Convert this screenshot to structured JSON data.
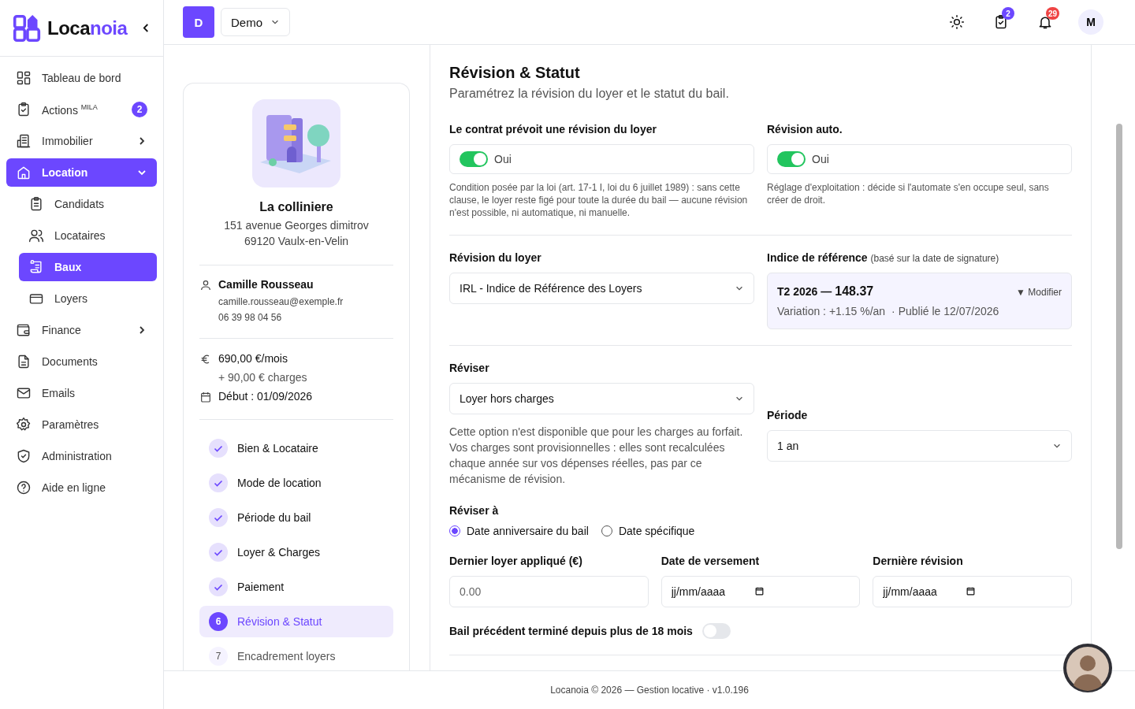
{
  "sidebar": {
    "brand": {
      "first": "Loca",
      "second": "noia"
    },
    "items": [
      {
        "label": "Tableau de bord",
        "selected": false
      },
      {
        "label": "Actions $^{MILA}$",
        "badge": "2",
        "selected": false
      },
      {
        "label": "Immobilier",
        "selected": false,
        "expanded": false
      },
      {
        "label": "Location",
        "selected": true,
        "expanded": true,
        "children": [
          {
            "label": "Candidats",
            "selected": false
          },
          {
            "label": "Locataires",
            "selected": false
          },
          {
            "label": "Baux",
            "selected": true
          },
          {
            "label": "Loyers",
            "selected": false
          }
        ]
      },
      {
        "label": "Finance",
        "selected": false,
        "expanded": false
      },
      {
        "label": "Documents",
        "selected": false
      },
      {
        "label": "Emails",
        "selected": false
      },
      {
        "label": "Paramètres",
        "selected": false
      },
      {
        "label": "Administration",
        "selected": false
      },
      {
        "label": "Aide en ligne",
        "selected": false
      }
    ]
  },
  "header": {
    "workspace_initial": "D",
    "workspace": "Demo",
    "tasks_badge": "2",
    "notifications_badge": "29",
    "user_initial": "M"
  },
  "summary": {
    "property_name": "La colliniere",
    "address": [
      "151 avenue Georges dimitrov",
      "69120 Vaulx-en-Velin"
    ],
    "tenant": {
      "name": "Camille Rousseau",
      "email": "camille.rousseau@exemple.fr",
      "phone": "06 39 98 04 56"
    },
    "rent": "690,00 €/mois",
    "charges": "+ 90,00 € charges",
    "start": "Début : 01/09/2026",
    "steps": [
      {
        "kind": "done",
        "label": "Bien & Locataire",
        "selected": false
      },
      {
        "kind": "done",
        "label": "Mode de location",
        "selected": false
      },
      {
        "kind": "done",
        "label": "Période du bail",
        "selected": false
      },
      {
        "kind": "done",
        "label": "Loyer & Charges",
        "selected": false
      },
      {
        "kind": "done",
        "label": "Paiement",
        "selected": false
      },
      {
        "kind": "current",
        "number": "6",
        "label": "Révision & Statut",
        "selected": true
      },
      {
        "kind": "pending",
        "number": "7",
        "label": "Encadrement loyers",
        "selected": false
      }
    ]
  },
  "form": {
    "title": "Révision & Statut",
    "subtitle": "Paramétrez la révision du loyer et le statut du bail.",
    "toggles": [
      {
        "label": "Le contrat prévoit une révision du loyer",
        "on": true,
        "value": "Oui",
        "help": "Condition posée par la loi (art. 17-1 I, loi du 6 juillet 1989) : sans cette clause, le loyer reste figé pour toute la durée du bail — aucune révision n'est possible, ni automatique, ni manuelle."
      },
      {
        "label": "Révision auto.",
        "on": true,
        "value": "Oui",
        "help": "Réglage d'exploitation : décide si l'automate s'en occupe seul, sans créer de droit."
      }
    ],
    "revision": {
      "label": "Révision du loyer",
      "value": "IRL - Indice de Référence des Loyers"
    },
    "index": {
      "label": "Indice de référence",
      "note": "(basé sur la date de signature)",
      "period": "T2 2026 —",
      "value": "148.37",
      "action": "▼ Modifier",
      "variation": "Variation : +1.15 %/an",
      "published": "· Publié le 12/07/2026"
    },
    "revise": {
      "label": "Réviser",
      "value": "Loyer hors charges",
      "help": "Cette option n'est disponible que pour les charges au forfait. Vos charges sont provisionnelles : elles sont recalculées chaque année sur vos dépenses réelles, pas par ce mécanisme de révision."
    },
    "period": {
      "label": "Période",
      "value": "1 an"
    },
    "revise_at": {
      "label": "Réviser à",
      "options": [
        {
          "label": "Date anniversaire du bail",
          "selected": true
        },
        {
          "label": "Date spécifique",
          "selected": false
        }
      ]
    },
    "inputs": [
      {
        "kind": "number",
        "label": "Dernier loyer appliqué (€)",
        "placeholder": "0.00"
      },
      {
        "kind": "date",
        "label": "Date de versement",
        "placeholder": "jj/mm/aaaa"
      },
      {
        "kind": "date",
        "label": "Dernière révision",
        "placeholder": "jj/mm/aaaa"
      }
    ],
    "previous_lease": {
      "label": "Bail précédent terminé depuis plus de 18 mois",
      "on": false
    }
  },
  "footer": "Locanoia © 2026 — Gestion locative · v1.0.196"
}
